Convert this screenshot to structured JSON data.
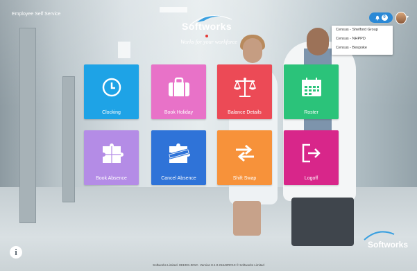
{
  "header": {
    "app_title": "Employee Self Service",
    "logo_text": "Softworks",
    "logo_tagline": "Works for your workforce"
  },
  "notifications": {
    "count": "0",
    "icon": "bell-icon"
  },
  "user_menu": {
    "options": [
      "Census - Shelford Group",
      "Census - NHPPD",
      "Census - Bespoke"
    ]
  },
  "tiles": [
    {
      "label": "Clocking",
      "icon": "clock-icon",
      "color": "#1ea3e6"
    },
    {
      "label": "Book Holiday",
      "icon": "suitcase-icon",
      "color": "#e872c8"
    },
    {
      "label": "Balance Details",
      "icon": "scales-icon",
      "color": "#ec4a56"
    },
    {
      "label": "Roster",
      "icon": "calendar-icon",
      "color": "#2bc37a"
    },
    {
      "label": "Book Absence",
      "icon": "puzzle-icon",
      "color": "#b48ce6"
    },
    {
      "label": "Cancel Absence",
      "icon": "cancelled-puzzle-icon",
      "color": "#2f73d8"
    },
    {
      "label": "Shift Swap",
      "icon": "swap-arrows-icon",
      "color": "#f7923a"
    },
    {
      "label": "Logoff",
      "icon": "logout-icon",
      "color": "#d8268a"
    }
  ],
  "footer": {
    "text": "Softworks Limited. 891001-001C. Version 8.1.0.21642RC13  © Softworks Limited"
  },
  "corner_logo": "Softworks"
}
